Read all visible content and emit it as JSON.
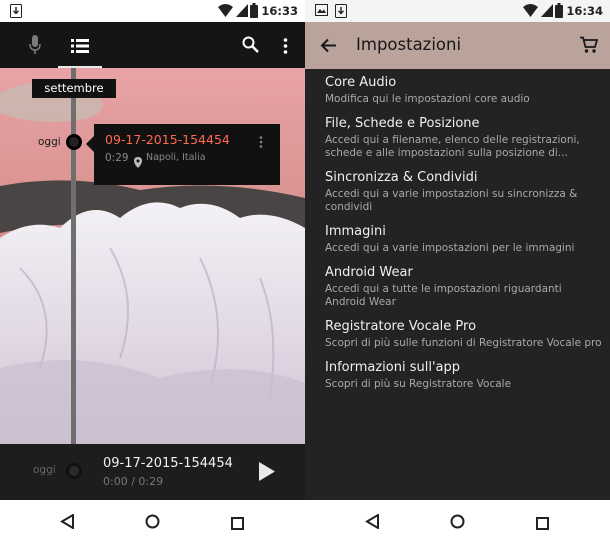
{
  "left": {
    "status_time": "16:33",
    "month_label": "settembre",
    "today_label": "oggi",
    "recording": {
      "title": "09-17-2015-154454",
      "duration": "0:29",
      "location": "Napoli, Italia"
    },
    "player": {
      "title": "09-17-2015-154454",
      "progress": "0:00 / 0:29",
      "today_label": "oggi"
    }
  },
  "right": {
    "status_time": "16:34",
    "screen_title": "Impostazioni",
    "settings": [
      {
        "title": "Core Audio",
        "subtitle": "Modifica qui le impostazioni core audio"
      },
      {
        "title": "File, Schede e Posizione",
        "subtitle": "Accedi qui a filename, elenco delle registrazioni, schede e alle impostazioni sulla posizione di..."
      },
      {
        "title": "Sincronizza & Condividi",
        "subtitle": "Accedi qui a varie impostazioni su sincronizza & condividi"
      },
      {
        "title": "Immagini",
        "subtitle": "Accedi qui a varie impostazioni per le immagini"
      },
      {
        "title": "Android Wear",
        "subtitle": "Accedi qui a tutte le impostazioni riguardanti Android Wear"
      },
      {
        "title": "Registratore Vocale Pro",
        "subtitle": "Scopri di più sulle funzioni di Registratore Vocale pro"
      },
      {
        "title": "Informazioni sull'app",
        "subtitle": "Scopri di più su Registratore Vocale"
      }
    ]
  },
  "icons": {
    "download": "download-icon",
    "gallery": "image-icon",
    "wifi": "wifi-icon",
    "signal": "cell-signal-icon",
    "battery": "battery-icon",
    "mic": "microphone-icon",
    "list": "list-icon",
    "search": "search-icon",
    "more": "more-vert-icon",
    "back": "back-arrow-icon",
    "cart": "cart-icon",
    "location": "location-pin-icon",
    "play": "play-icon",
    "nav_back": "nav-back-icon",
    "nav_home": "nav-home-icon",
    "nav_recents": "nav-recents-icon"
  },
  "colors": {
    "accent": "#ff6a4f",
    "right_toolbar": "#b9a39b",
    "dark_bg": "#202020"
  }
}
